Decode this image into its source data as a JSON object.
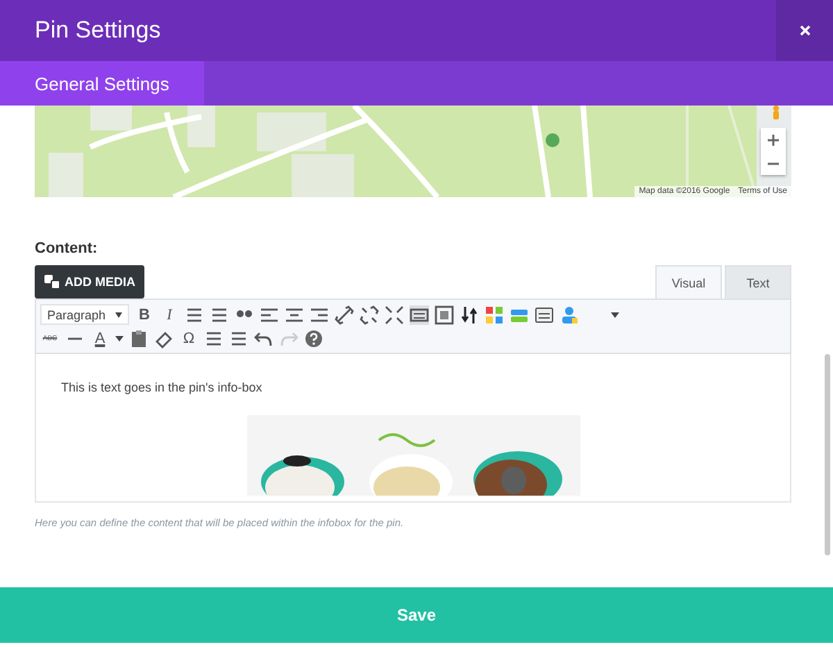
{
  "window": {
    "title": "Pin Settings"
  },
  "tabs": [
    {
      "label": "General Settings",
      "selected": true
    }
  ],
  "map": {
    "attribution": "Map data ©2016 Google",
    "terms": "Terms of Use"
  },
  "content": {
    "label": "Content:",
    "add_media": "ADD MEDIA",
    "editor_tabs": [
      {
        "label": "Visual",
        "selected": true
      },
      {
        "label": "Text",
        "selected": false
      }
    ],
    "format": "Paragraph",
    "glyphs": {
      "bold": "B",
      "italic": "I",
      "strike": "ABC",
      "text_color": "A",
      "omega": "Ω"
    },
    "text": "This is text goes in the pin's info-box",
    "description": "Here you can define the content that will be placed within the infobox for the pin."
  },
  "save": "Save"
}
